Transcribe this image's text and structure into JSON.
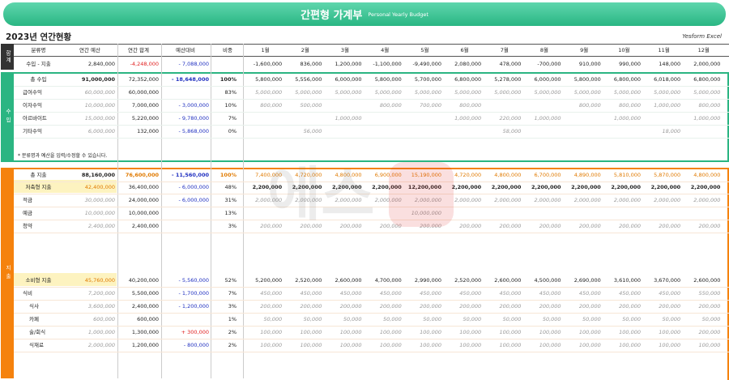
{
  "banner": {
    "title": "간편형 가계부",
    "subtitle": "Personal Yearly Budget"
  },
  "page_title": "2023년 연간현황",
  "brand": "Yesform Excel",
  "side_labels": {
    "summary": "합계",
    "income": "수입",
    "expense": "지출"
  },
  "headers": {
    "category": "분류명",
    "budget": "연간 예산",
    "total": "연간 합계",
    "diff": "예산대비",
    "ratio": "비중",
    "months": [
      "1월",
      "2월",
      "3월",
      "4월",
      "5월",
      "6월",
      "7월",
      "8월",
      "9월",
      "10월",
      "11월",
      "12월"
    ]
  },
  "summary_row": {
    "label": "수입 - 지출",
    "budget": "2,840,000",
    "total": "-4,248,000",
    "diff": "- 7,088,000",
    "months": [
      "-1,600,000",
      "836,000",
      "1,200,000",
      "-1,100,000",
      "-9,490,000",
      "2,080,000",
      "478,000",
      "-700,000",
      "910,000",
      "990,000",
      "148,000",
      "2,000,000"
    ]
  },
  "income_total": {
    "label": "총 수입",
    "budget": "91,000,000",
    "total": "72,352,000",
    "diff": "- 18,648,000",
    "ratio": "100%",
    "months": [
      "5,800,000",
      "5,556,000",
      "6,000,000",
      "5,800,000",
      "5,700,000",
      "6,800,000",
      "5,278,000",
      "6,000,000",
      "5,800,000",
      "6,800,000",
      "6,018,000",
      "6,800,000"
    ]
  },
  "income_items": [
    {
      "label": "급여수익",
      "budget": "60,000,000",
      "total": "60,000,000",
      "diff": "",
      "ratio": "83%",
      "months": [
        "5,000,000",
        "5,000,000",
        "5,000,000",
        "5,000,000",
        "5,000,000",
        "5,000,000",
        "5,000,000",
        "5,000,000",
        "5,000,000",
        "5,000,000",
        "5,000,000",
        "5,000,000"
      ]
    },
    {
      "label": "이자수익",
      "budget": "10,000,000",
      "total": "7,000,000",
      "diff": "- 3,000,000",
      "ratio": "10%",
      "months": [
        "800,000",
        "500,000",
        "",
        "800,000",
        "700,000",
        "800,000",
        "",
        "",
        "800,000",
        "800,000",
        "1,000,000",
        "800,000"
      ]
    },
    {
      "label": "아르바이트",
      "budget": "15,000,000",
      "total": "5,220,000",
      "diff": "- 9,780,000",
      "ratio": "7%",
      "months": [
        "",
        "",
        "1,000,000",
        "",
        "",
        "1,000,000",
        "220,000",
        "1,000,000",
        "",
        "1,000,000",
        "",
        "1,000,000"
      ]
    },
    {
      "label": "기타수익",
      "budget": "6,000,000",
      "total": "132,000",
      "diff": "- 5,868,000",
      "ratio": "0%",
      "months": [
        "",
        "56,000",
        "",
        "",
        "",
        "",
        "58,000",
        "",
        "",
        "",
        "18,000",
        ""
      ]
    }
  ],
  "income_note": "* 분류명과 예산을 입력/수정할 수 있습니다.",
  "expense_total": {
    "label": "총 지출",
    "budget": "88,160,000",
    "total": "76,600,000",
    "diff": "- 11,560,000",
    "ratio": "100%",
    "months": [
      "7,400,000",
      "4,720,000",
      "4,800,000",
      "6,900,000",
      "15,190,000",
      "4,720,000",
      "4,800,000",
      "6,700,000",
      "4,890,000",
      "5,810,000",
      "5,870,000",
      "4,800,000"
    ]
  },
  "saving_total": {
    "label": "저축형 지출",
    "budget": "42,400,000",
    "total": "36,400,000",
    "diff": "- 6,000,000",
    "ratio": "48%",
    "months": [
      "2,200,000",
      "2,200,000",
      "2,200,000",
      "2,200,000",
      "12,200,000",
      "2,200,000",
      "2,200,000",
      "2,200,000",
      "2,200,000",
      "2,200,000",
      "2,200,000",
      "2,200,000"
    ]
  },
  "saving_items": [
    {
      "label": "적금",
      "budget": "30,000,000",
      "total": "24,000,000",
      "diff": "- 6,000,000",
      "ratio": "31%",
      "months": [
        "2,000,000",
        "2,000,000",
        "2,000,000",
        "2,000,000",
        "2,000,000",
        "2,000,000",
        "2,000,000",
        "2,000,000",
        "2,000,000",
        "2,000,000",
        "2,000,000",
        "2,000,000"
      ]
    },
    {
      "label": "예금",
      "budget": "10,000,000",
      "total": "10,000,000",
      "diff": "",
      "ratio": "13%",
      "months": [
        "",
        "",
        "",
        "",
        "10,000,000",
        "",
        "",
        "",
        "",
        "",
        "",
        ""
      ]
    },
    {
      "label": "청약",
      "budget": "2,400,000",
      "total": "2,400,000",
      "diff": "",
      "ratio": "3%",
      "months": [
        "200,000",
        "200,000",
        "200,000",
        "200,000",
        "200,000",
        "200,000",
        "200,000",
        "200,000",
        "200,000",
        "200,000",
        "200,000",
        "200,000"
      ]
    }
  ],
  "consume_total": {
    "label": "소비형 지출",
    "budget": "45,760,000",
    "total": "40,200,000",
    "diff": "- 5,560,000",
    "ratio": "52%",
    "months": [
      "5,200,000",
      "2,520,000",
      "2,600,000",
      "4,700,000",
      "2,990,000",
      "2,520,000",
      "2,600,000",
      "4,500,000",
      "2,690,000",
      "3,610,000",
      "3,670,000",
      "2,600,000"
    ]
  },
  "consume_items": [
    {
      "label": "식비",
      "budget": "7,200,000",
      "total": "5,500,000",
      "diff": "- 1,700,000",
      "ratio": "7%",
      "months": [
        "450,000",
        "450,000",
        "450,000",
        "450,000",
        "450,000",
        "450,000",
        "450,000",
        "450,000",
        "450,000",
        "450,000",
        "450,000",
        "550,000"
      ]
    },
    {
      "label": "식사",
      "budget": "3,600,000",
      "total": "2,400,000",
      "diff": "- 1,200,000",
      "ratio": "3%",
      "months": [
        "200,000",
        "200,000",
        "200,000",
        "200,000",
        "200,000",
        "200,000",
        "200,000",
        "200,000",
        "200,000",
        "200,000",
        "200,000",
        "200,000"
      ]
    },
    {
      "label": "카페",
      "budget": "600,000",
      "total": "600,000",
      "diff": "",
      "ratio": "1%",
      "months": [
        "50,000",
        "50,000",
        "50,000",
        "50,000",
        "50,000",
        "50,000",
        "50,000",
        "50,000",
        "50,000",
        "50,000",
        "50,000",
        "50,000"
      ]
    },
    {
      "label": "술/회식",
      "budget": "1,000,000",
      "total": "1,300,000",
      "diff": "+ 300,000",
      "ratio": "2%",
      "months": [
        "100,000",
        "100,000",
        "100,000",
        "100,000",
        "100,000",
        "100,000",
        "100,000",
        "100,000",
        "100,000",
        "100,000",
        "100,000",
        "200,000"
      ]
    },
    {
      "label": "식재료",
      "budget": "2,000,000",
      "total": "1,200,000",
      "diff": "- 800,000",
      "ratio": "2%",
      "months": [
        "100,000",
        "100,000",
        "100,000",
        "100,000",
        "100,000",
        "100,000",
        "100,000",
        "100,000",
        "100,000",
        "100,000",
        "100,000",
        "100,000"
      ]
    }
  ],
  "colors": {
    "green": "#2bb582",
    "green_dark": "#1a7a55",
    "orange": "#f5820d",
    "orange_text": "#e07a00",
    "red": "#e02020",
    "blue": "#2030c0",
    "yellow_fill": "#fdf3c0"
  }
}
